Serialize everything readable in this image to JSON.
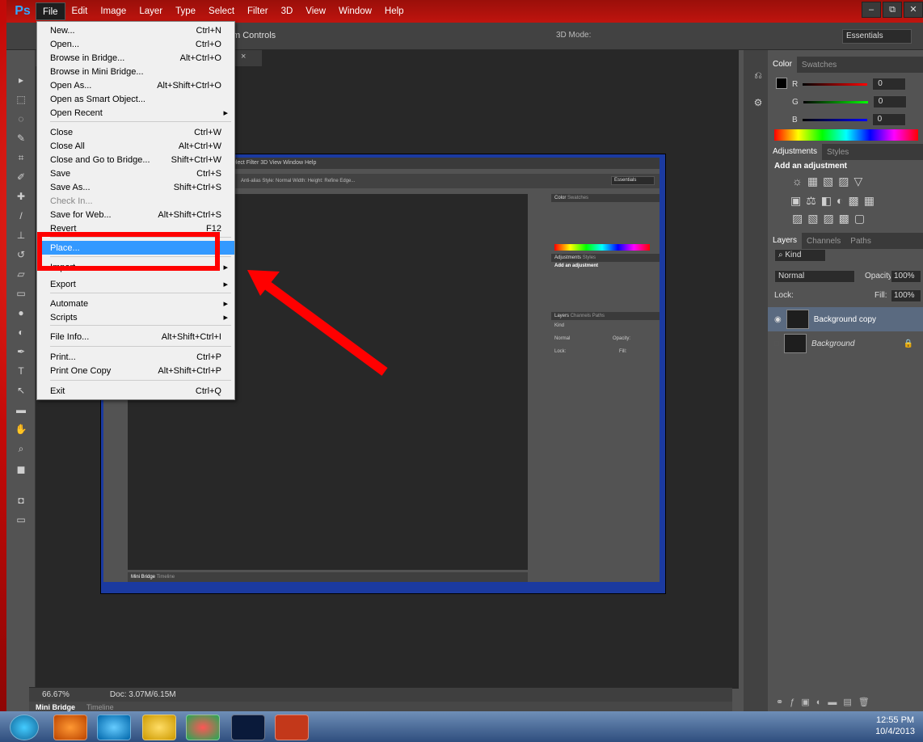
{
  "app": {
    "logo": "Ps",
    "menus": [
      "File",
      "Edit",
      "Image",
      "Layer",
      "Type",
      "Select",
      "Filter",
      "3D",
      "View",
      "Window",
      "Help"
    ],
    "window_controls": [
      "–",
      "⧉",
      "✕"
    ]
  },
  "options_bar": {
    "controls_label": "m Controls",
    "three_d_mode_label": "3D Mode:",
    "workspace": "Essentials"
  },
  "document": {
    "tab_close": "×",
    "zoom": "66.67%",
    "doc_info": "Doc: 3.07M/6.15M",
    "bottom_tabs": [
      "Mini Bridge",
      "Timeline"
    ]
  },
  "file_menu": {
    "items": [
      {
        "label": "New...",
        "shortcut": "Ctrl+N"
      },
      {
        "label": "Open...",
        "shortcut": "Ctrl+O"
      },
      {
        "label": "Browse in Bridge...",
        "shortcut": "Alt+Ctrl+O"
      },
      {
        "label": "Browse in Mini Bridge...",
        "shortcut": ""
      },
      {
        "label": "Open As...",
        "shortcut": "Alt+Shift+Ctrl+O"
      },
      {
        "label": "Open as Smart Object...",
        "shortcut": ""
      },
      {
        "label": "Open Recent",
        "shortcut": ""
      },
      {
        "label": "Close",
        "shortcut": "Ctrl+W"
      },
      {
        "label": "Close All",
        "shortcut": "Alt+Ctrl+W"
      },
      {
        "label": "Close and Go to Bridge...",
        "shortcut": "Shift+Ctrl+W"
      },
      {
        "label": "Save",
        "shortcut": "Ctrl+S"
      },
      {
        "label": "Save As...",
        "shortcut": "Shift+Ctrl+S"
      },
      {
        "label": "Check In...",
        "shortcut": ""
      },
      {
        "label": "Save for Web...",
        "shortcut": "Alt+Shift+Ctrl+S"
      },
      {
        "label": "Revert",
        "shortcut": "F12"
      },
      {
        "label": "Place...",
        "shortcut": ""
      },
      {
        "label": "Import",
        "shortcut": ""
      },
      {
        "label": "Export",
        "shortcut": ""
      },
      {
        "label": "Automate",
        "shortcut": ""
      },
      {
        "label": "Scripts",
        "shortcut": ""
      },
      {
        "label": "File Info...",
        "shortcut": "Alt+Shift+Ctrl+I"
      },
      {
        "label": "Print...",
        "shortcut": "Ctrl+P"
      },
      {
        "label": "Print One Copy",
        "shortcut": "Alt+Shift+Ctrl+P"
      },
      {
        "label": "Exit",
        "shortcut": "Ctrl+Q"
      }
    ]
  },
  "color_panel": {
    "tabs": [
      "Color",
      "Swatches"
    ],
    "channels": [
      {
        "label": "R",
        "value": "0"
      },
      {
        "label": "G",
        "value": "0"
      },
      {
        "label": "B",
        "value": "0"
      }
    ]
  },
  "adjustments_panel": {
    "tabs": [
      "Adjustments",
      "Styles"
    ],
    "heading": "Add an adjustment"
  },
  "layers_panel": {
    "tabs": [
      "Layers",
      "Channels",
      "Paths"
    ],
    "kind": "Kind",
    "blend_mode": "Normal",
    "opacity_label": "Opacity:",
    "opacity": "100%",
    "lock_label": "Lock:",
    "fill_label": "Fill:",
    "fill": "100%",
    "layers": [
      "Background copy",
      "Background"
    ]
  },
  "inner_screenshot": {
    "menus": "elect  Filter  3D  View  Window  Help",
    "options": "Anti-alias   Style:  Normal   Width:   Height:   Refine Edge...",
    "workspace": "Essentials",
    "panel_tabs": [
      "Color",
      "Swatches",
      "Adjustments",
      "Styles",
      "Layers",
      "Channels",
      "Paths"
    ],
    "adjust_heading": "Add an adjustment",
    "kind": "Kind",
    "blend": "Normal",
    "opacity": "Opacity:",
    "lock": "Lock:",
    "fill": "Fill:",
    "bottom_tabs": [
      "Mini Bridge",
      "Timeline"
    ]
  },
  "taskbar": {
    "time": "12:55 PM",
    "date": "10/4/2013"
  }
}
